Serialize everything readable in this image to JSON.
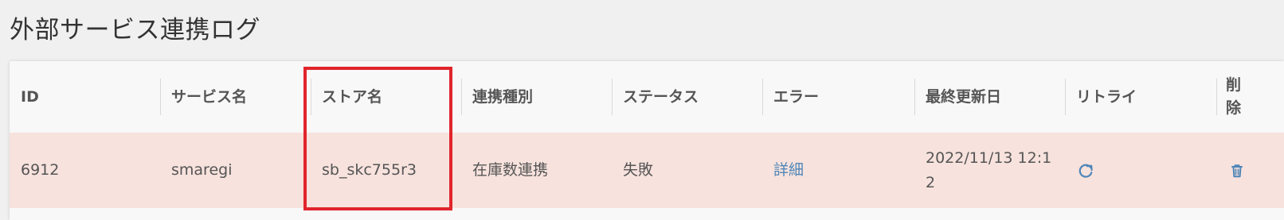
{
  "page": {
    "title": "外部サービス連携ログ"
  },
  "table": {
    "headers": [
      "ID",
      "サービス名",
      "ストア名",
      "連携種別",
      "ステータス",
      "エラー",
      "最終更新日",
      "リトライ",
      "削除"
    ],
    "rows": [
      {
        "id": "6912",
        "service": "smaregi",
        "store": "sb_skc755r3",
        "type": "在庫数連携",
        "status": "失敗",
        "error_link": "詳細",
        "updated": "2022/11/13 12:12",
        "retry_icon": "refresh-icon",
        "delete_icon": "trash-icon"
      }
    ]
  },
  "colors": {
    "row_error_background": "#f7e2dd",
    "link": "#4f86b8",
    "highlight": "#e0252b"
  }
}
